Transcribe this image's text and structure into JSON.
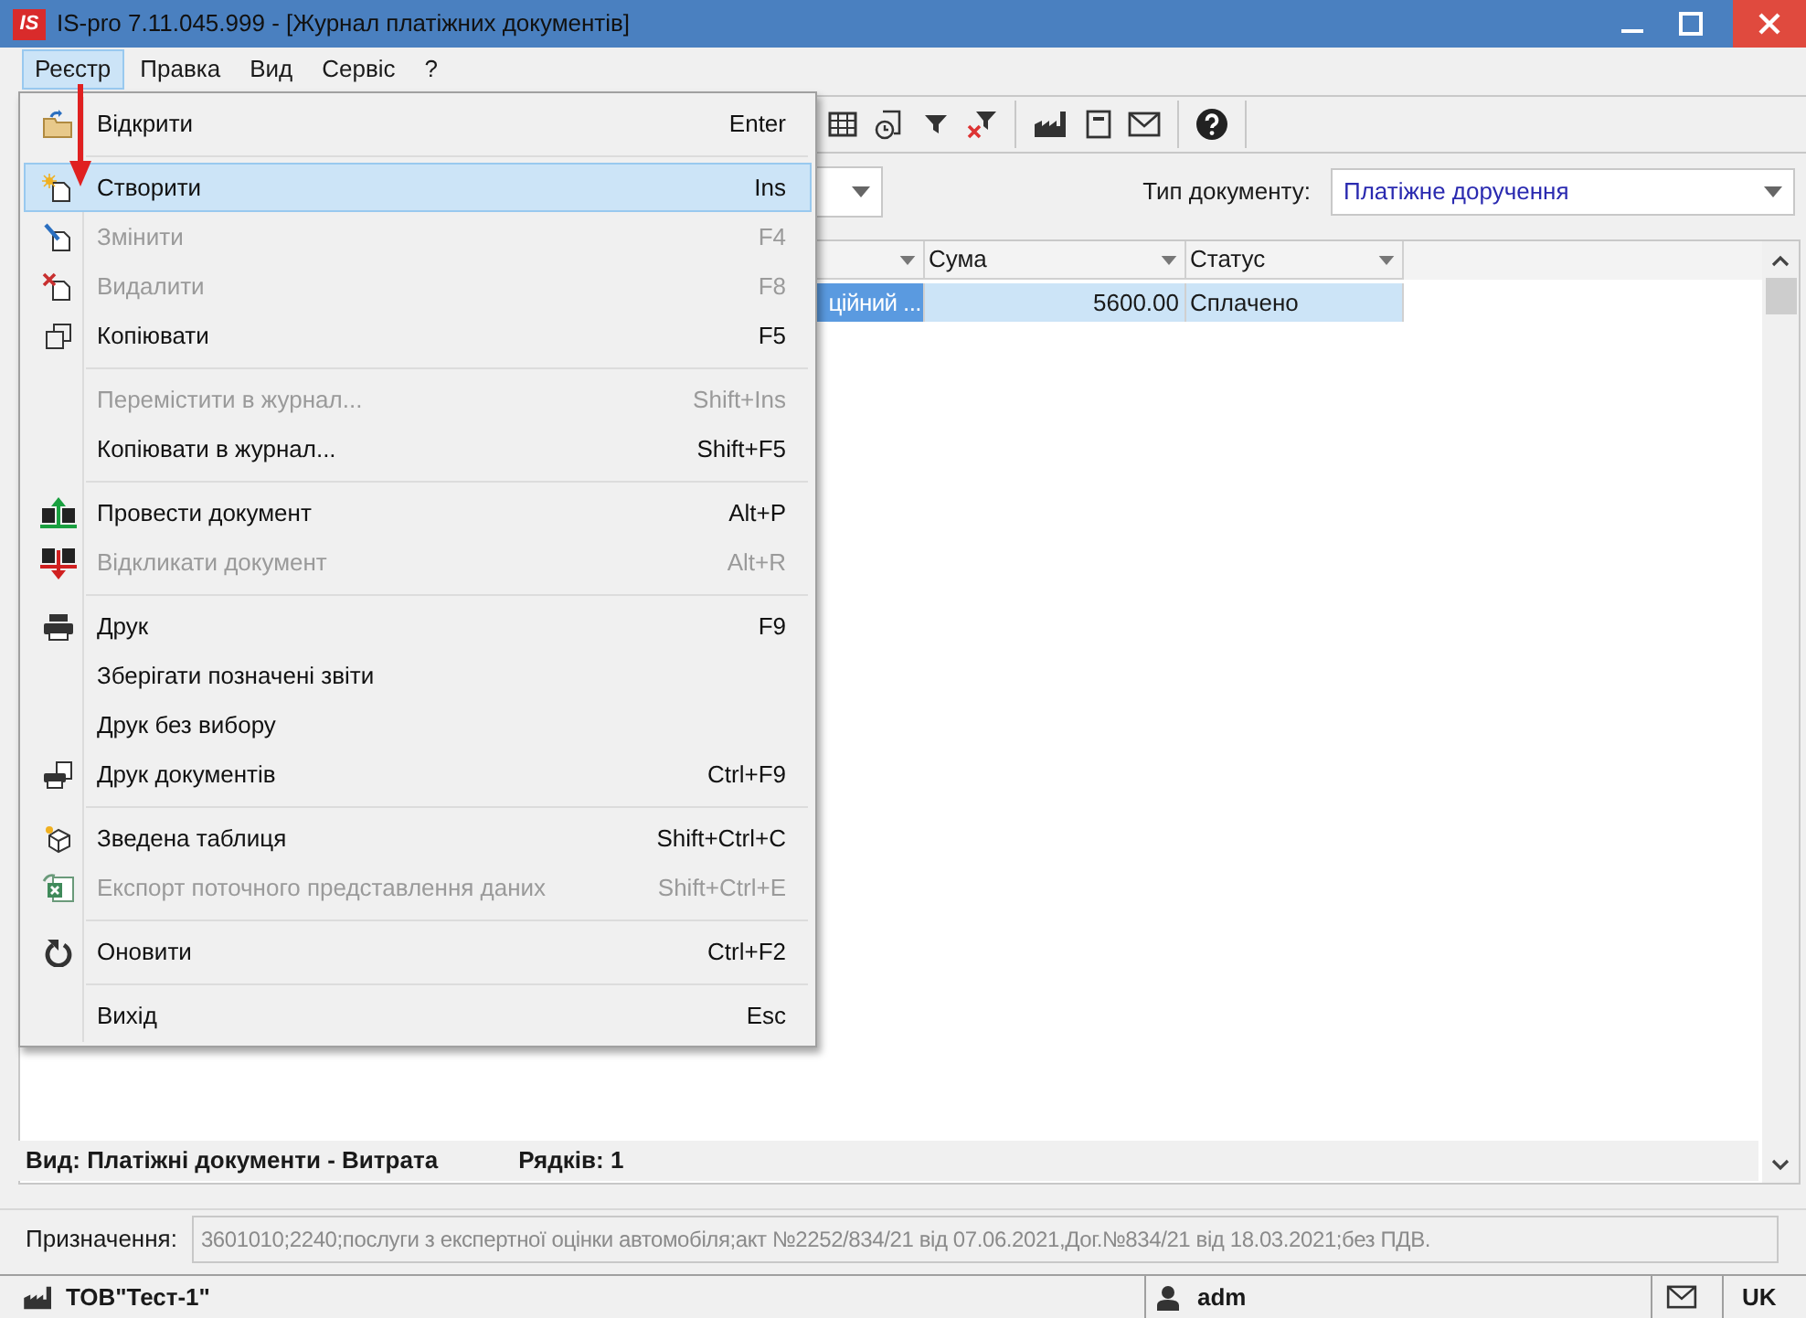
{
  "window": {
    "logo": "IS",
    "title": "IS-pro 7.11.045.999 - [Журнал платіжних документів]"
  },
  "menubar": [
    {
      "label": "Реєстр",
      "selected": true
    },
    {
      "label": "Правка",
      "selected": false
    },
    {
      "label": "Вид",
      "selected": false
    },
    {
      "label": "Сервіс",
      "selected": false
    },
    {
      "label": "?",
      "selected": false
    }
  ],
  "menu": [
    {
      "kind": "item",
      "label": "Відкрити",
      "shortcut": "Enter",
      "disabled": false,
      "selected": false
    },
    {
      "kind": "separator"
    },
    {
      "kind": "item",
      "label": "Створити",
      "shortcut": "Ins",
      "disabled": false,
      "selected": true
    },
    {
      "kind": "item",
      "label": "Змінити",
      "shortcut": "F4",
      "disabled": true,
      "selected": false
    },
    {
      "kind": "item",
      "label": "Видалити",
      "shortcut": "F8",
      "disabled": true,
      "selected": false
    },
    {
      "kind": "item",
      "label": "Копіювати",
      "shortcut": "F5",
      "disabled": false,
      "selected": false
    },
    {
      "kind": "separator"
    },
    {
      "kind": "item",
      "label": "Перемістити в журнал...",
      "shortcut": "Shift+Ins",
      "disabled": true,
      "selected": false
    },
    {
      "kind": "item",
      "label": "Копіювати в журнал...",
      "shortcut": "Shift+F5",
      "disabled": false,
      "selected": false
    },
    {
      "kind": "separator"
    },
    {
      "kind": "item",
      "label": "Провести документ",
      "shortcut": "Alt+P",
      "disabled": false,
      "selected": false
    },
    {
      "kind": "item",
      "label": "Відкликати документ",
      "shortcut": "Alt+R",
      "disabled": true,
      "selected": false
    },
    {
      "kind": "separator"
    },
    {
      "kind": "item",
      "label": "Друк",
      "shortcut": "F9",
      "disabled": false,
      "selected": false
    },
    {
      "kind": "item",
      "label": "Зберігати позначені звіти",
      "disabled": false,
      "selected": false
    },
    {
      "kind": "item",
      "label": "Друк без вибору",
      "disabled": false,
      "selected": false
    },
    {
      "kind": "item",
      "label": "Друк документів",
      "shortcut": "Ctrl+F9",
      "disabled": false,
      "selected": false
    },
    {
      "kind": "separator"
    },
    {
      "kind": "item",
      "label": "Зведена таблиця",
      "shortcut": "Shift+Ctrl+C",
      "disabled": false,
      "selected": false
    },
    {
      "kind": "item",
      "label": "Експорт поточного представлення даних",
      "shortcut": "Shift+Ctrl+E",
      "disabled": true,
      "selected": false
    },
    {
      "kind": "separator"
    },
    {
      "kind": "item",
      "label": "Оновити",
      "shortcut": "Ctrl+F2",
      "disabled": false,
      "selected": false
    },
    {
      "kind": "separator"
    },
    {
      "kind": "item",
      "label": "Вихід",
      "shortcut": "Esc",
      "disabled": false,
      "selected": false
    }
  ],
  "filter": {
    "label": "Тип документу:",
    "value": "Платіжне доручення"
  },
  "table": {
    "columns": [
      {
        "label": "Сума"
      },
      {
        "label": "Статус"
      }
    ],
    "rows": [
      {
        "column_1": "ційний ...",
        "amount": "5600.00",
        "status": "Сплачено",
        "selected": true
      }
    ]
  },
  "view_bar": {
    "view": "Вид: Платіжні документи - Витрата",
    "rows": "Рядків: 1"
  },
  "purpose": {
    "label": "Призначення:",
    "value": "3601010;2240;послуги з експертної оцінки автомобіля;акт №2252/834/21 від 07.06.2021,Дог.№834/21 від 18.03.2021;без ПДВ."
  },
  "status_bar": {
    "company": "ТОВ\"Тест-1\"",
    "user": "adm",
    "language": "UK"
  }
}
